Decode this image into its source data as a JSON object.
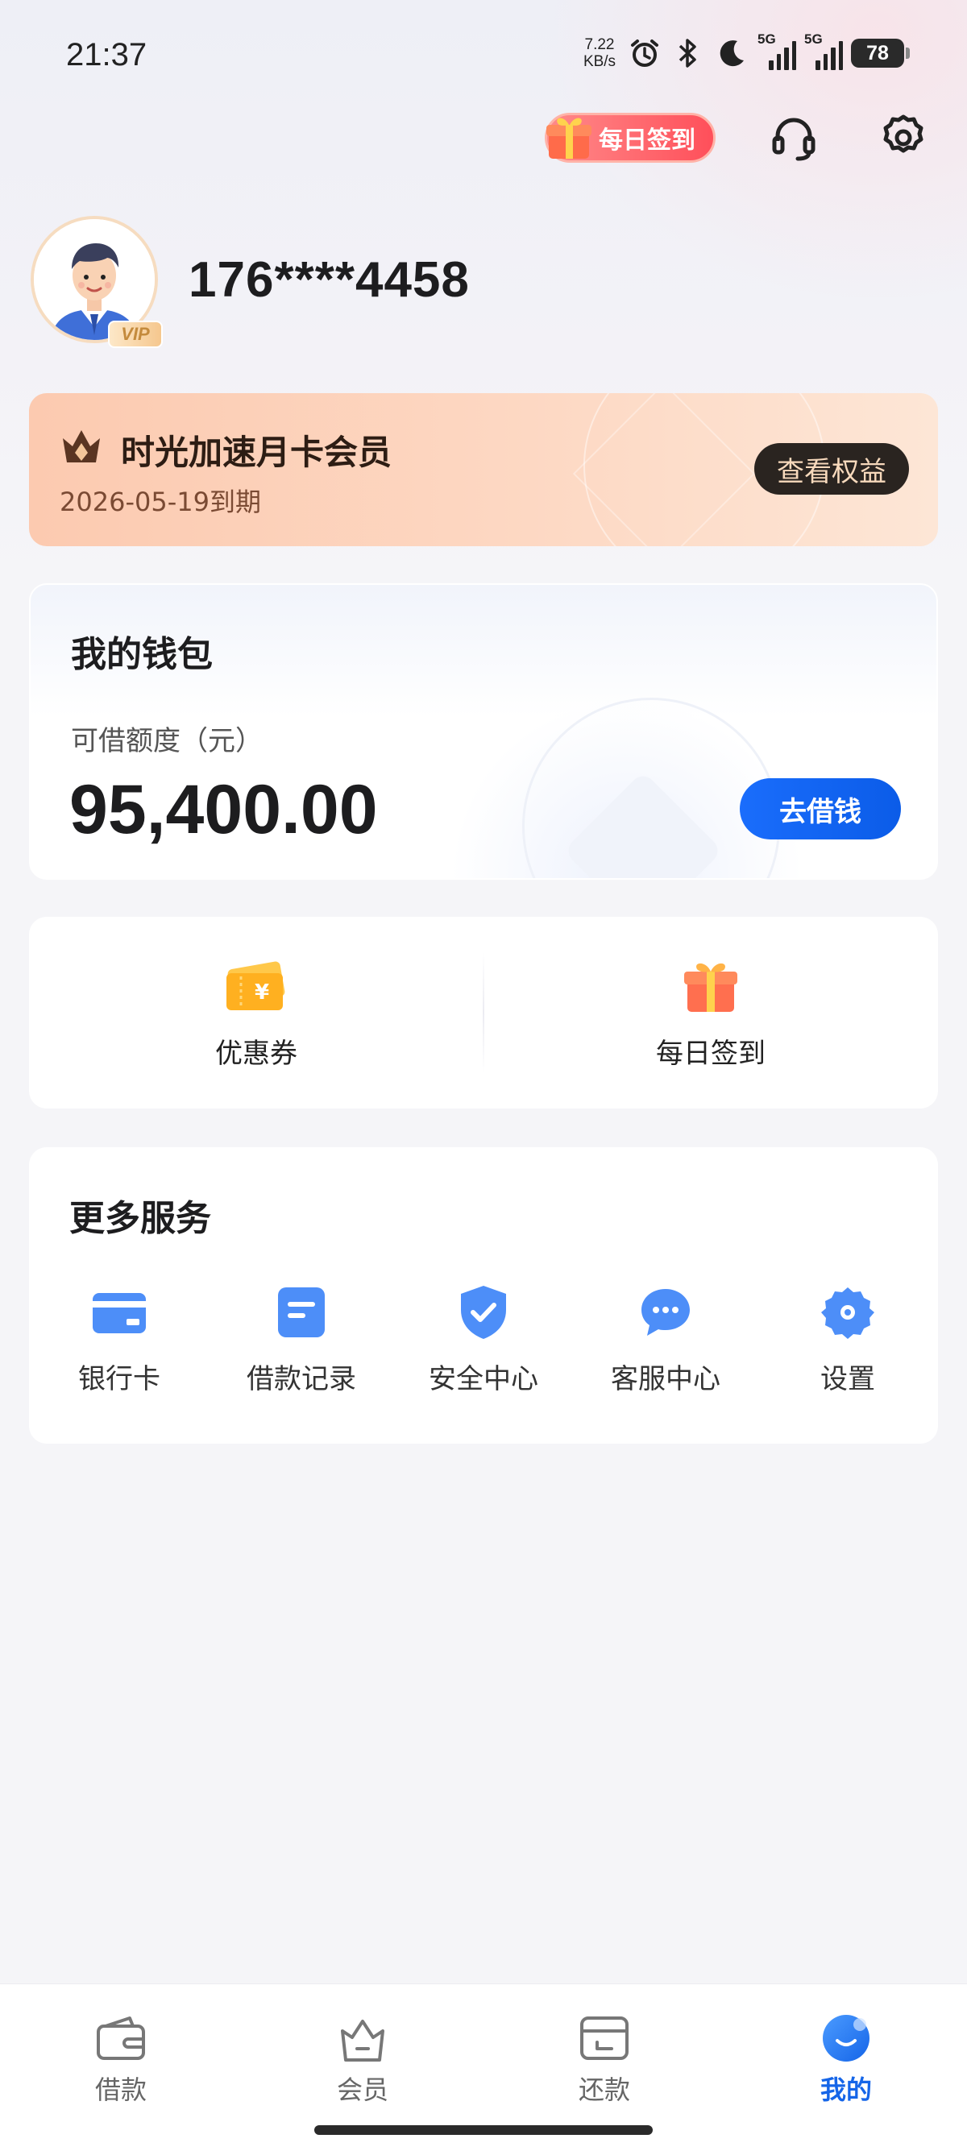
{
  "status_bar": {
    "time": "21:37",
    "net_speed_value": "7.22",
    "net_speed_unit": "KB/s",
    "signal_1_label": "5G",
    "signal_2_label": "5G",
    "battery": "78"
  },
  "header": {
    "checkin_label": "每日签到",
    "icons": [
      "headset-icon",
      "gear-icon"
    ]
  },
  "profile": {
    "phone": "176****4458",
    "vip_badge": "VIP"
  },
  "membership": {
    "title": "时光加速月卡会员",
    "expiry": "2026-05-19到期",
    "benefit_button": "查看权益",
    "icon": "crown-icon"
  },
  "wallet": {
    "title": "我的钱包",
    "credit_label": "可借额度（元）",
    "credit_amount": "95,400.00",
    "borrow_button": "去借钱"
  },
  "quick_actions": [
    {
      "label": "优惠券",
      "icon": "coupon-icon"
    },
    {
      "label": "每日签到",
      "icon": "gift-icon"
    }
  ],
  "more_services": {
    "title": "更多服务",
    "items": [
      {
        "label": "银行卡",
        "icon": "bank-card-icon"
      },
      {
        "label": "借款记录",
        "icon": "record-icon"
      },
      {
        "label": "安全中心",
        "icon": "shield-icon"
      },
      {
        "label": "客服中心",
        "icon": "chat-icon"
      },
      {
        "label": "设置",
        "icon": "gear-icon"
      }
    ]
  },
  "tab_bar": {
    "tabs": [
      {
        "label": "借款",
        "icon": "wallet-icon",
        "active": false
      },
      {
        "label": "会员",
        "icon": "member-bag-icon",
        "active": false
      },
      {
        "label": "还款",
        "icon": "repay-icon",
        "active": false
      },
      {
        "label": "我的",
        "icon": "profile-smile-icon",
        "active": true
      }
    ]
  },
  "colors": {
    "accent_blue": "#1565e8",
    "member_card": "#fccab0",
    "checkin_red": "#ff4f5a"
  }
}
